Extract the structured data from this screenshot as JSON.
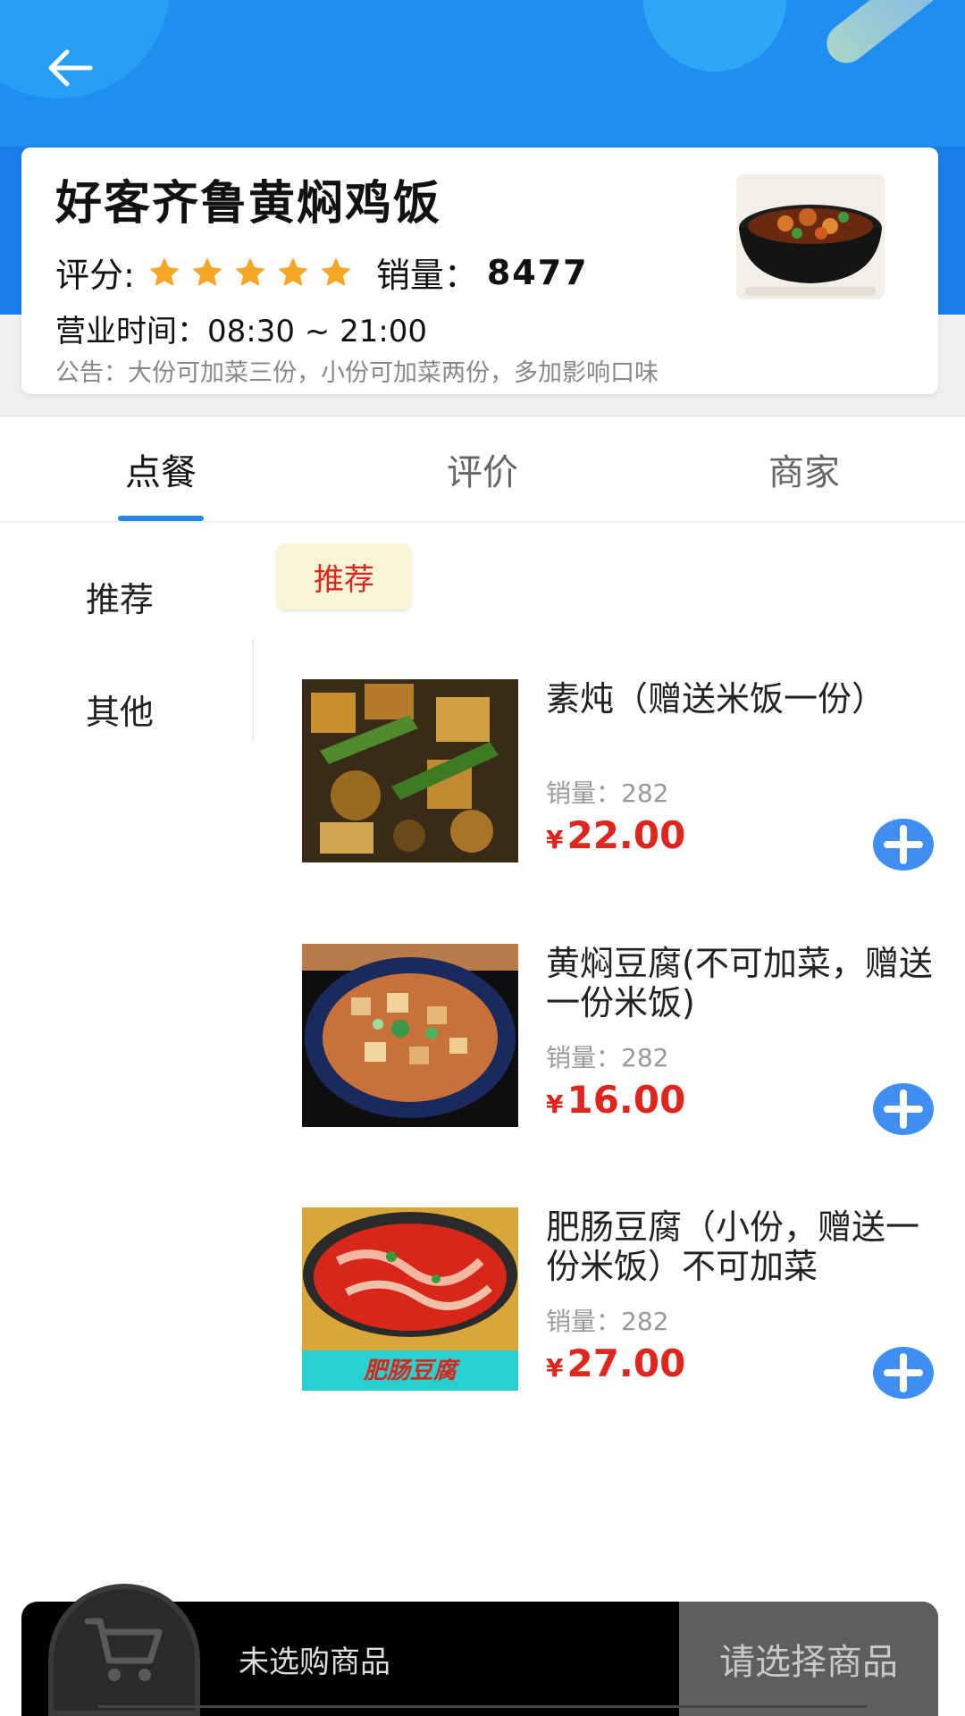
{
  "colors": {
    "primary_blue": "#1e88f0",
    "price_red": "#e0251c",
    "star_orange": "#f5a623"
  },
  "shop": {
    "name": "好客齐鲁黄焖鸡饭",
    "rating_label": "评分:",
    "stars": 5,
    "sales_label": "销量：",
    "sales_value": "8477",
    "hours": "营业时间：08:30 ~ 21:00",
    "notice": "公告：大份可加菜三份，小份可加菜两份，多加影响口味"
  },
  "tabs": [
    {
      "label": "点餐",
      "active": true
    },
    {
      "label": "评价",
      "active": false
    },
    {
      "label": "商家",
      "active": false
    }
  ],
  "sidebar": {
    "items": [
      {
        "label": "推荐"
      },
      {
        "label": "其他"
      }
    ]
  },
  "category_chip": "推荐",
  "products": [
    {
      "name": "素炖（赠送米饭一份）",
      "sales": "销量：282",
      "currency": "¥",
      "price": "22.00"
    },
    {
      "name": "黄焖豆腐(不可加菜，赠送一份米饭)",
      "sales": "销量：282",
      "currency": "¥",
      "price": "16.00"
    },
    {
      "name": "肥肠豆腐（小份，赠送一份米饭）不可加菜",
      "sales": "销量：282",
      "currency": "¥",
      "price": "27.00",
      "image_caption": "肥肠豆腐"
    }
  ],
  "cart": {
    "empty_text": "未选购商品",
    "checkout_label": "请选择商品"
  }
}
